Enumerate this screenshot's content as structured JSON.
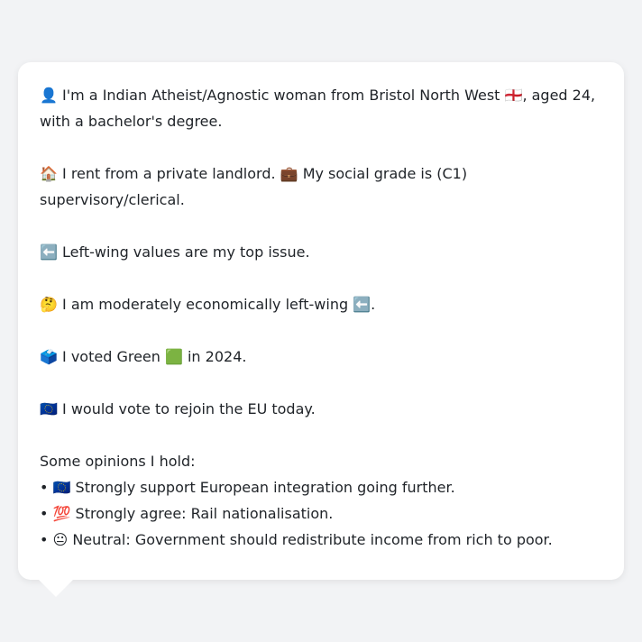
{
  "identity": {
    "icon": "👤",
    "text": "I'm a Indian Atheist/Agnostic woman from Bristol North West 🏴󠁧󠁢󠁥󠁮󠁧󠁿, aged 24, with a bachelor's degree."
  },
  "housing": {
    "icon": "🏠",
    "text": "I rent from a private landlord.",
    "grade_icon": "💼",
    "grade_text": "My social grade is (C1) supervisory/clerical."
  },
  "issue": {
    "icon": "⬅️",
    "text": "Left-wing values are my top issue."
  },
  "economic": {
    "icon": "🤔",
    "text": "I am moderately economically left-wing ⬅️."
  },
  "vote": {
    "icon": "🗳️",
    "text": "I voted Green 🟩 in 2024."
  },
  "eu": {
    "icon": "🇪🇺",
    "text": "I would vote to rejoin the EU today."
  },
  "opinions": {
    "heading": "Some opinions I hold:",
    "items": [
      {
        "icon": "🇪🇺",
        "text": "Strongly support European integration going further."
      },
      {
        "icon": "💯",
        "text": "Strongly agree: Rail nationalisation."
      },
      {
        "icon": "😐",
        "text": "Neutral: Government should redistribute income from rich to poor."
      }
    ]
  }
}
